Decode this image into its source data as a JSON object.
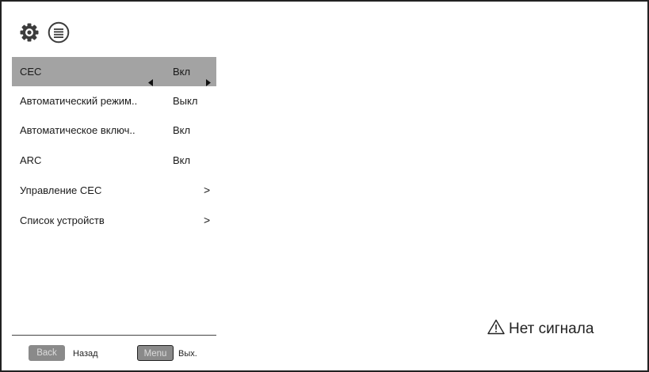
{
  "icons": {
    "settings": "gear-icon",
    "menu": "list-circle-icon"
  },
  "menu": {
    "items": [
      {
        "label": "CEC",
        "value": "Вкл",
        "selected": true
      },
      {
        "label": "Автоматический режим..",
        "value": "Выкл"
      },
      {
        "label": "Автоматическое включ..",
        "value": "Вкл"
      },
      {
        "label": "ARC",
        "value": "Вкл"
      },
      {
        "label": "Управление CEC",
        "chevron": ">"
      },
      {
        "label": "Список устройств",
        "chevron": ">"
      }
    ]
  },
  "footer": {
    "back_key": "Back",
    "back_label": "Назад",
    "menu_key": "Menu",
    "menu_label": "Вых."
  },
  "status": {
    "no_signal": "Нет сигнала",
    "icon": "warning-icon"
  },
  "colors": {
    "selected_row": "#a3a3a3",
    "key_bg": "#8a8a8a"
  }
}
